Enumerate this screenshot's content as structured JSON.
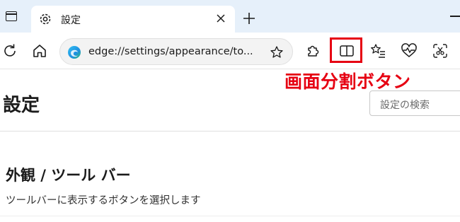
{
  "browser": {
    "tab_title": "設定",
    "url": "edge://settings/appearance/to..."
  },
  "annotation": {
    "text": "画面分割ボタン",
    "color": "#e60012"
  },
  "settings": {
    "page_title": "設定",
    "search_placeholder": "設定の検索",
    "section_title": "外観 / ツール バー",
    "section_description": "ツールバーに表示するボタンを選択します"
  },
  "icons": [
    "tab-actions-icon",
    "gear-icon",
    "close-icon",
    "new-tab-icon",
    "refresh-icon",
    "home-icon",
    "edge-logo-icon",
    "favorite-star-icon",
    "extensions-icon",
    "split-screen-icon",
    "favorites-list-icon",
    "browser-essentials-icon",
    "web-capture-icon"
  ]
}
